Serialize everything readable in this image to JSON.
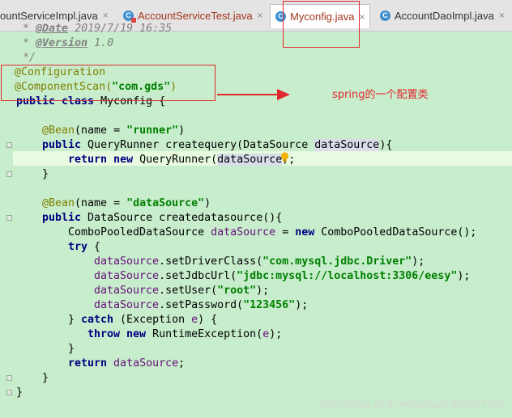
{
  "tabs": [
    {
      "label": "AccountServiceImpl.java",
      "display": "ountServiceImpl.java",
      "icon": "class-icon",
      "active": false
    },
    {
      "label": "AccountServiceTest.java",
      "icon": "test-class-icon",
      "active": false
    },
    {
      "label": "Myconfig.java",
      "icon": "class-icon",
      "active": true
    },
    {
      "label": "AccountDaoImpl.java",
      "icon": "class-icon",
      "active": false
    }
  ],
  "tab_close_glyph": "×",
  "tab_icon_glyph": "C",
  "code": {
    "l1_prefix": " * ",
    "l1_tag": "@Date",
    "l1_rest": " 2019/7/19 16:35",
    "l2_prefix": " * ",
    "l2_tag": "@Version",
    "l2_rest": " 1.0",
    "l3": " */",
    "l4": "@Configuration",
    "l5_ann": "@ComponentScan(",
    "l5_str": "\"com.gds\"",
    "l5_end": ")",
    "l6_kw": "public class",
    "l6_rest": " Myconfig {",
    "l8_ann": "@Bean",
    "l8_a": "(name = ",
    "l8_str": "\"runner\"",
    "l8_b": ")",
    "l9_kw": "public",
    "l9_a": " QueryRunner createquery(DataSource ",
    "l9_param": "dataSource",
    "l9_b": "){",
    "l10_kw1": "return",
    "l10_kw2": "new",
    "l10_a": " QueryRunner(",
    "l10_param": "dataSource",
    "l10_b": ");",
    "l11": "    }",
    "l13_ann": "@Bean",
    "l13_a": "(name = ",
    "l13_str": "\"dataSource\"",
    "l13_b": ")",
    "l14_kw": "public",
    "l14_rest": " DataSource createdatasource(){",
    "l15_a": "ComboPooledDataSource ",
    "l15_fld": "dataSource",
    "l15_b": " = ",
    "l15_kw": "new",
    "l15_c": " ComboPooledDataSource();",
    "l16_kw": "try",
    "l16_rest": " {",
    "l17_fld": "dataSource",
    "l17_a": ".setDriverClass(",
    "l17_str": "\"com.mysql.jdbc.Driver\"",
    "l17_b": ");",
    "l18_fld": "dataSource",
    "l18_a": ".setJdbcUrl(",
    "l18_str": "\"jdbc:mysql://localhost:3306/eesy\"",
    "l18_b": ");",
    "l19_fld": "dataSource",
    "l19_a": ".setUser(",
    "l19_str": "\"root\"",
    "l19_b": ");",
    "l20_fld": "dataSource",
    "l20_a": ".setPassword(",
    "l20_str": "\"123456\"",
    "l20_b": ");",
    "l21_a": "} ",
    "l21_kw": "catch",
    "l21_b": " (Exception ",
    "l21_fld": "e",
    "l21_c": ") {",
    "l22_kw1": "throw",
    "l22_kw2": "new",
    "l22_a": " RuntimeException(",
    "l22_fld": "e",
    "l22_b": ");",
    "l23": "        }",
    "l24_kw": "return",
    "l24_fld": " dataSource",
    "l24_b": ";",
    "l25": "    }",
    "l26": "}"
  },
  "annotation_note": "spring的一个配置类",
  "watermark": "https://blog.csdn.net/gdsgdh308227363",
  "colors": {
    "background": "#c7edcc",
    "keyword": "#000080",
    "string": "#008000",
    "annotation": "#808000",
    "highlight": "#e2282e"
  }
}
